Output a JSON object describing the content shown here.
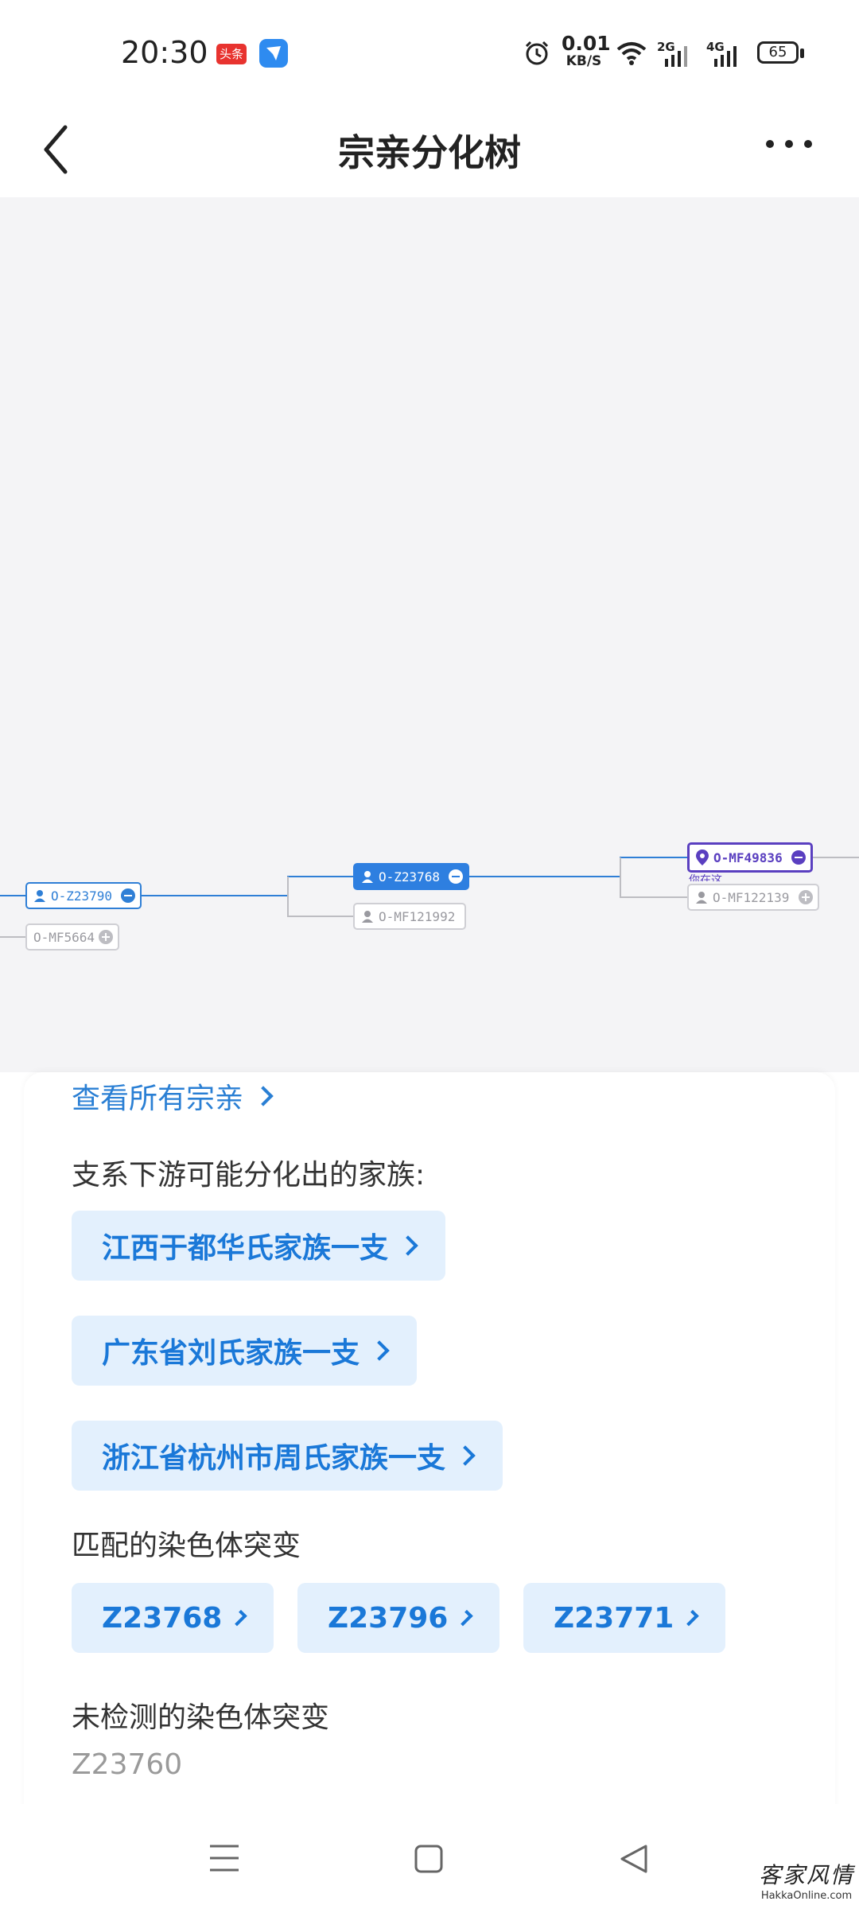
{
  "status_bar": {
    "time": "20:30",
    "badge_red_text": "头条",
    "net_speed_value": "0.01",
    "net_speed_unit": "KB/S",
    "signal_1_label": "2G",
    "signal_2_label": "4G",
    "battery": "65"
  },
  "header": {
    "title": "宗亲分化树"
  },
  "tree": {
    "nodes": [
      {
        "label": "O-Z23790",
        "style": "primary"
      },
      {
        "label": "O-MF5664",
        "style": "gray"
      },
      {
        "label": "O-Z23768",
        "style": "selected"
      },
      {
        "label": "O-MF121992",
        "style": "gray"
      },
      {
        "label": "O-MF49836",
        "style": "purple",
        "sublabel": "你在这"
      },
      {
        "label": "O-MF122139",
        "style": "gray"
      }
    ]
  },
  "card": {
    "view_all": "查看所有宗亲",
    "downstream_title": "支系下游可能分化出的家族:",
    "families": [
      "江西于都华氏家族一支",
      "广东省刘氏家族一支",
      "浙江省杭州市周氏家族一支"
    ],
    "matched_title": "匹配的染色体突变",
    "matched_mutations": [
      "Z23768",
      "Z23796",
      "Z23771"
    ],
    "untested_title": "未检测的染色体突变",
    "untested_mutations": [
      "Z23760"
    ]
  },
  "watermark": {
    "line1": "客家风情",
    "line2": "HakkaOnline.com"
  },
  "colors": {
    "accent": "#2a7fd4",
    "pill_bg": "#e3f0fd",
    "you_are_here": "#5a3fc0",
    "tree_bg": "#f4f4f6"
  }
}
